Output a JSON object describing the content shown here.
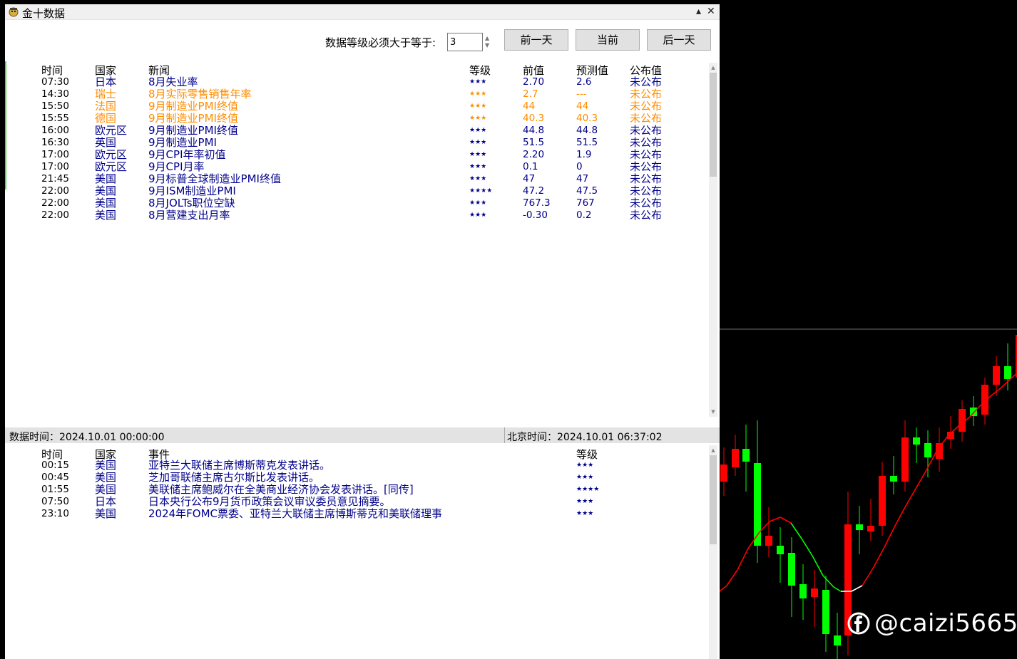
{
  "window": {
    "title": "金十数据"
  },
  "filter": {
    "label": "数据等级必须大于等于:",
    "value": "3"
  },
  "buttons": {
    "prev_day": "前一天",
    "today": "当前",
    "next_day": "后一天"
  },
  "news_table": {
    "headers": {
      "time": "时间",
      "country": "国家",
      "news": "新闻",
      "level": "等级",
      "previous": "前值",
      "forecast": "预测值",
      "actual": "公布值"
    },
    "rows": [
      {
        "time": "07:30",
        "country": "日本",
        "news": "8月失业率",
        "level": "★★★",
        "previous": "2.70",
        "forecast": "2.6",
        "actual": "未公布",
        "color": "blue"
      },
      {
        "time": "14:30",
        "country": "瑞士",
        "news": "8月实际零售销售年率",
        "level": "★★★",
        "previous": "2.7",
        "forecast": "---",
        "actual": "未公布",
        "color": "orange"
      },
      {
        "time": "15:50",
        "country": "法国",
        "news": "9月制造业PMI终值",
        "level": "★★★",
        "previous": "44",
        "forecast": "44",
        "actual": "未公布",
        "color": "orange"
      },
      {
        "time": "15:55",
        "country": "德国",
        "news": "9月制造业PMI终值",
        "level": "★★★",
        "previous": "40.3",
        "forecast": "40.3",
        "actual": "未公布",
        "color": "orange"
      },
      {
        "time": "16:00",
        "country": "欧元区",
        "news": "9月制造业PMI终值",
        "level": "★★★",
        "previous": "44.8",
        "forecast": "44.8",
        "actual": "未公布",
        "color": "blue"
      },
      {
        "time": "16:30",
        "country": "英国",
        "news": "9月制造业PMI",
        "level": "★★★",
        "previous": "51.5",
        "forecast": "51.5",
        "actual": "未公布",
        "color": "blue"
      },
      {
        "time": "17:00",
        "country": "欧元区",
        "news": "9月CPI年率初值",
        "level": "★★★",
        "previous": "2.20",
        "forecast": "1.9",
        "actual": "未公布",
        "color": "blue"
      },
      {
        "time": "17:00",
        "country": "欧元区",
        "news": "9月CPI月率",
        "level": "★★★",
        "previous": "0.1",
        "forecast": "0",
        "actual": "未公布",
        "color": "blue"
      },
      {
        "time": "21:45",
        "country": "美国",
        "news": "9月标普全球制造业PMI终值",
        "level": "★★★",
        "previous": "47",
        "forecast": "47",
        "actual": "未公布",
        "color": "blue"
      },
      {
        "time": "22:00",
        "country": "美国",
        "news": "9月ISM制造业PMI",
        "level": "★★★★",
        "previous": "47.2",
        "forecast": "47.5",
        "actual": "未公布",
        "color": "blue"
      },
      {
        "time": "22:00",
        "country": "美国",
        "news": "8月JOLTs职位空缺",
        "level": "★★★",
        "previous": "767.3",
        "forecast": "767",
        "actual": "未公布",
        "color": "blue"
      },
      {
        "time": "22:00",
        "country": "美国",
        "news": "8月营建支出月率",
        "level": "★★★",
        "previous": "-0.30",
        "forecast": "0.2",
        "actual": "未公布",
        "color": "blue"
      }
    ]
  },
  "status": {
    "data_time": "数据时间：2024.10.01 00:00:00",
    "beijing_time": "北京时间：2024.10.01 06:37:02"
  },
  "events_table": {
    "headers": {
      "time": "时间",
      "country": "国家",
      "event": "事件",
      "level": "等级"
    },
    "rows": [
      {
        "time": "00:15",
        "country": "美国",
        "event": "亚特兰大联储主席博斯蒂克发表讲话。",
        "level": "★★★"
      },
      {
        "time": "00:45",
        "country": "美国",
        "event": "芝加哥联储主席古尔斯比发表讲话。",
        "level": "★★★"
      },
      {
        "time": "01:55",
        "country": "美国",
        "event": "美联储主席鲍威尔在全美商业经济协会发表讲话。[同传]",
        "level": "★★★★"
      },
      {
        "time": "07:50",
        "country": "日本",
        "event": "日本央行公布9月货币政策会议审议委员意见摘要。",
        "level": "★★★"
      },
      {
        "time": "23:10",
        "country": "美国",
        "event": "2024年FOMC票委、亚特兰大联储主席博斯蒂克和美联储理事",
        "level": "★★★"
      }
    ]
  },
  "watermark": {
    "text": "@caizi5665"
  },
  "colors": {
    "bull": "#00ff00",
    "bear": "#ff0000",
    "ma_up": "#ff0000",
    "ma_down": "#00ff00",
    "ma_flat": "#ffffff",
    "row_blue": "#00008b",
    "row_orange": "#ff8c00"
  },
  "icons": {
    "window": "app-icon",
    "pin": "pin-icon",
    "close": "close-icon",
    "watermark": "facebook-icon"
  }
}
